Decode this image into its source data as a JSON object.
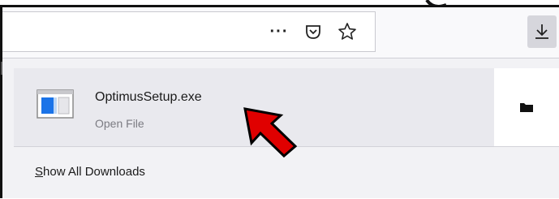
{
  "toolbar": {
    "page_actions_label": "···",
    "icons": [
      "page-actions-icon",
      "pocket-icon",
      "bookmark-star-icon",
      "download-icon"
    ]
  },
  "downloads": {
    "items": [
      {
        "name": "OptimusSetup.exe",
        "status": "Open File",
        "icon": "exe-file-icon"
      }
    ],
    "side_action_icon": "folder-icon",
    "show_all_label": "Show All Downloads",
    "show_all_accesskey": "S",
    "show_all_rest": "how All Downloads"
  },
  "annotation": {
    "color": "#e00000",
    "icon": "red-arrow-icon"
  },
  "colors": {
    "accent": "#1a73e8",
    "panel_bg": "#f2f2f5",
    "item_bg": "#e9e9ee",
    "button_active": "#d6d6dc"
  }
}
